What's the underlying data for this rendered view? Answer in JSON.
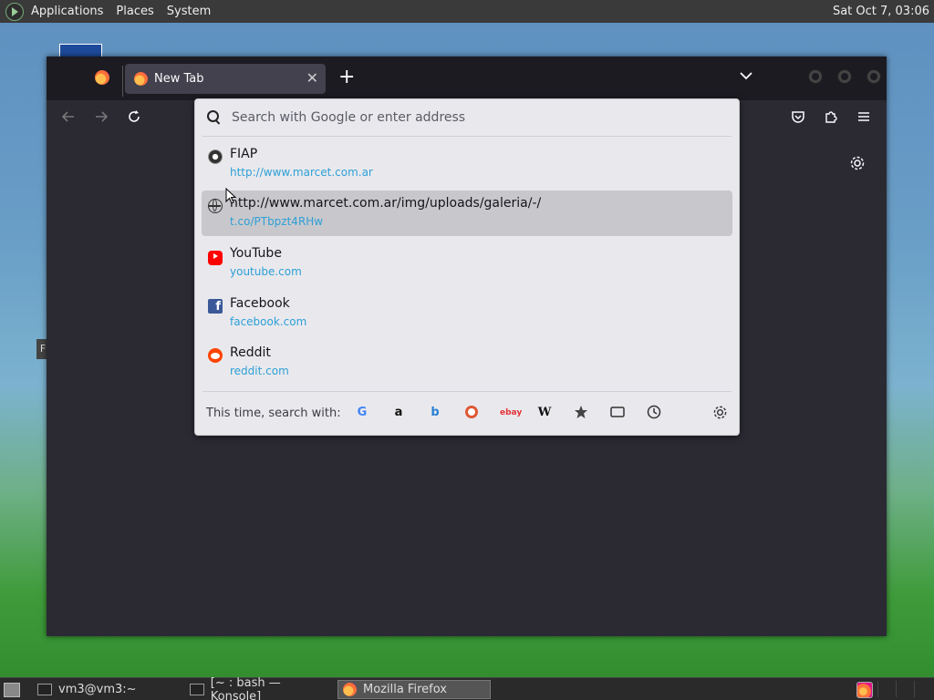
{
  "top_panel": {
    "menus": [
      "Applications",
      "Places",
      "System"
    ],
    "clock": "Sat Oct  7, 03:06"
  },
  "browser": {
    "tab_title": "New Tab",
    "urlbar_placeholder": "Search with Google or enter address",
    "results": [
      {
        "icon": "fiap-favicon",
        "title": "FIAP",
        "url": "http://www.marcet.com.ar",
        "selected": false
      },
      {
        "icon": "globe-icon",
        "title": "http://www.marcet.com.ar/img/uploads/galeria/-/",
        "url": "t.co/PTbpzt4RHw",
        "selected": true
      },
      {
        "icon": "youtube-icon",
        "title": "YouTube",
        "url": "youtube.com",
        "selected": false
      },
      {
        "icon": "facebook-icon",
        "title": "Facebook",
        "url": "facebook.com",
        "selected": false
      },
      {
        "icon": "reddit-icon",
        "title": "Reddit",
        "url": "reddit.com",
        "selected": false
      }
    ],
    "search_with_label": "This time, search with:",
    "engines": [
      "google",
      "amazon",
      "bing",
      "duckduckgo",
      "ebay",
      "wikipedia",
      "bookmarks",
      "tabs",
      "history"
    ]
  },
  "taskbar": {
    "tasks": [
      {
        "label": "vm3@vm3:~",
        "active": false
      },
      {
        "label": "[~ : bash — Konsole]",
        "active": false
      },
      {
        "label": "Mozilla Firefox",
        "active": true
      }
    ]
  }
}
